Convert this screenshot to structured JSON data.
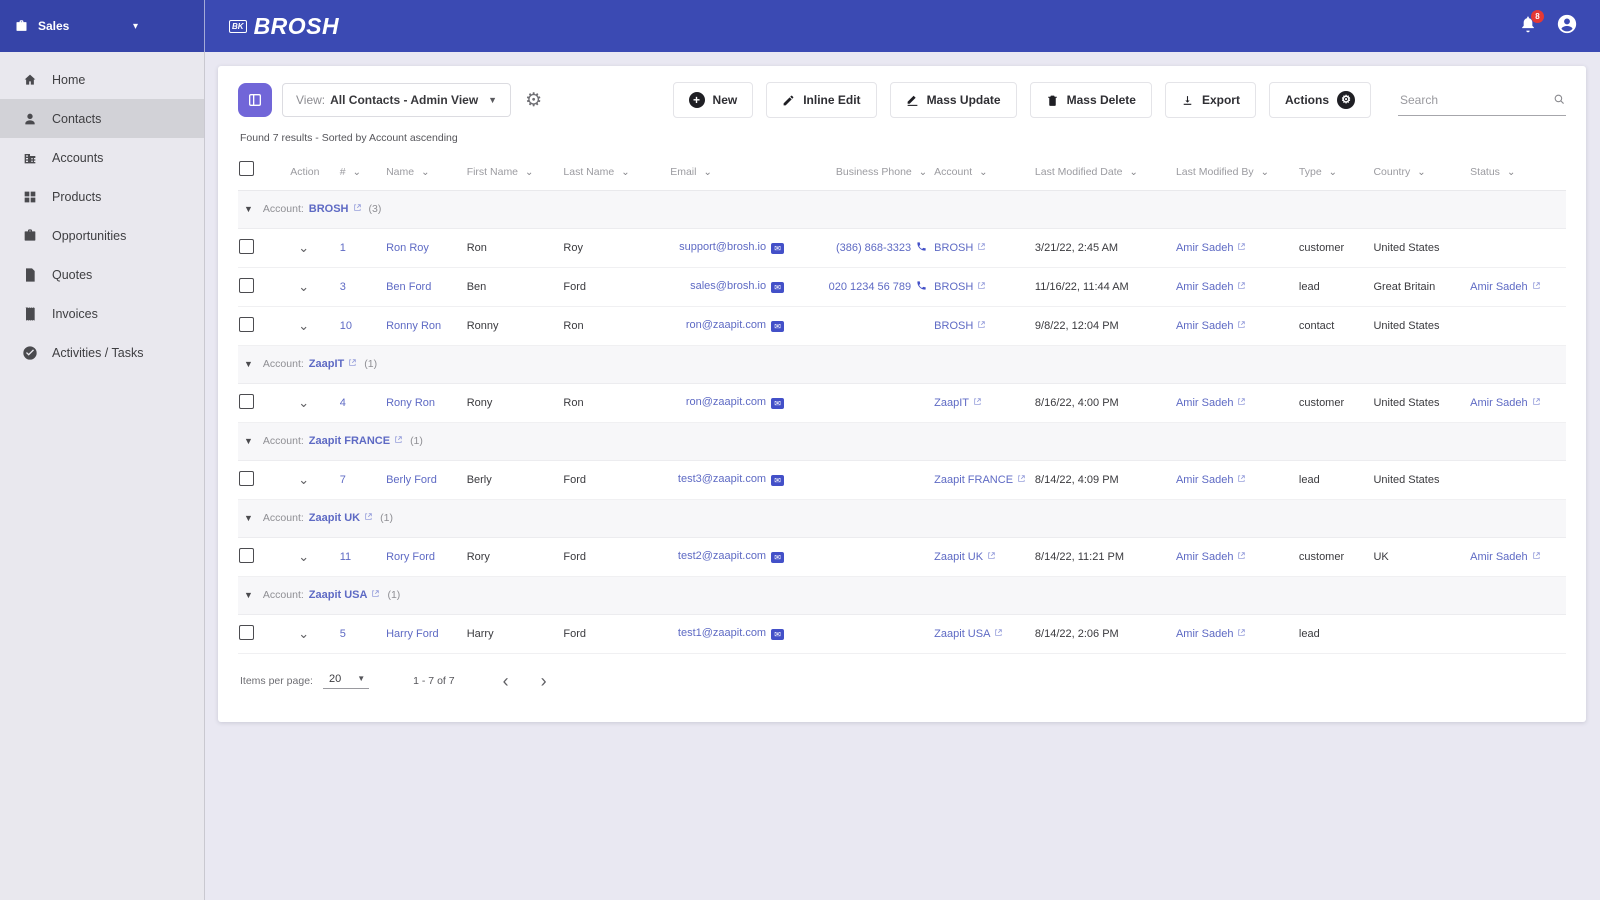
{
  "colors": {
    "topbar": "#3b4ab3",
    "link": "#5e6ac4",
    "view_icon_bg": "#7166d8",
    "notification_badge": "#e53935",
    "sidebar_active": "#d2d2d7"
  },
  "topbar": {
    "workspace": "Sales",
    "logo_badge": "BK",
    "logo": "BROSH",
    "notification_count": "8"
  },
  "sidebar": {
    "items": [
      {
        "label": "Home",
        "icon": "home",
        "active": false
      },
      {
        "label": "Contacts",
        "icon": "person",
        "active": true
      },
      {
        "label": "Accounts",
        "icon": "building",
        "active": false
      },
      {
        "label": "Products",
        "icon": "grid",
        "active": false
      },
      {
        "label": "Opportunities",
        "icon": "briefcase",
        "active": false
      },
      {
        "label": "Quotes",
        "icon": "doc",
        "active": false
      },
      {
        "label": "Invoices",
        "icon": "receipt",
        "active": false
      },
      {
        "label": "Activities / Tasks",
        "icon": "check",
        "active": false
      }
    ]
  },
  "toolbar": {
    "view_label": "View:",
    "view_value": "All Contacts - Admin View",
    "buttons": {
      "new": "New",
      "inline_edit": "Inline Edit",
      "mass_update": "Mass Update",
      "mass_delete": "Mass Delete",
      "export": "Export",
      "actions": "Actions"
    },
    "search_placeholder": "Search"
  },
  "results_summary": "Found 7 results - Sorted by Account ascending",
  "table": {
    "group_prefix": "Account:",
    "columns": [
      {
        "label": "Action",
        "filter": false
      },
      {
        "label": "#",
        "filter": true
      },
      {
        "label": "Name",
        "filter": true
      },
      {
        "label": "First Name",
        "filter": true
      },
      {
        "label": "Last Name",
        "filter": true
      },
      {
        "label": "Email",
        "filter": true
      },
      {
        "label": "Business Phone",
        "filter": true
      },
      {
        "label": "Account",
        "filter": true
      },
      {
        "label": "Last Modified Date",
        "filter": true
      },
      {
        "label": "Last Modified By",
        "filter": true
      },
      {
        "label": "Type",
        "filter": true
      },
      {
        "label": "Country",
        "filter": true
      },
      {
        "label": "Status",
        "filter": true
      }
    ],
    "groups": [
      {
        "account": "BROSH",
        "count": 3,
        "rows": [
          {
            "num": "1",
            "name": "Ron Roy",
            "first_name": "Ron",
            "last_name": "Roy",
            "email": "support@brosh.io",
            "phone": "(386) 868-3323",
            "account": "BROSH",
            "last_modified_date": "3/21/22, 2:45 AM",
            "last_modified_by": "Amir Sadeh",
            "type": "customer",
            "country": "United States",
            "status": ""
          },
          {
            "num": "3",
            "name": "Ben Ford",
            "first_name": "Ben",
            "last_name": "Ford",
            "email": "sales@brosh.io",
            "phone": "020 1234 56 789",
            "account": "BROSH",
            "last_modified_date": "11/16/22, 11:44 AM",
            "last_modified_by": "Amir Sadeh",
            "type": "lead",
            "country": "Great Britain",
            "status": "Amir Sadeh"
          },
          {
            "num": "10",
            "name": "Ronny Ron",
            "first_name": "Ronny",
            "last_name": "Ron",
            "email": "ron@zaapit.com",
            "phone": "",
            "account": "BROSH",
            "last_modified_date": "9/8/22, 12:04 PM",
            "last_modified_by": "Amir Sadeh",
            "type": "contact",
            "country": "United States",
            "status": ""
          }
        ]
      },
      {
        "account": "ZaapIT",
        "count": 1,
        "rows": [
          {
            "num": "4",
            "name": "Rony Ron",
            "first_name": "Rony",
            "last_name": "Ron",
            "email": "ron@zaapit.com",
            "phone": "",
            "account": "ZaapIT",
            "last_modified_date": "8/16/22, 4:00 PM",
            "last_modified_by": "Amir Sadeh",
            "type": "customer",
            "country": "United States",
            "status": "Amir Sadeh"
          }
        ]
      },
      {
        "account": "Zaapit FRANCE",
        "count": 1,
        "rows": [
          {
            "num": "7",
            "name": "Berly Ford",
            "first_name": "Berly",
            "last_name": "Ford",
            "email": "test3@zaapit.com",
            "phone": "",
            "account": "Zaapit FRANCE",
            "last_modified_date": "8/14/22, 4:09 PM",
            "last_modified_by": "Amir Sadeh",
            "type": "lead",
            "country": "United States",
            "status": ""
          }
        ]
      },
      {
        "account": "Zaapit UK",
        "count": 1,
        "rows": [
          {
            "num": "11",
            "name": "Rory Ford",
            "first_name": "Rory",
            "last_name": "Ford",
            "email": "test2@zaapit.com",
            "phone": "",
            "account": "Zaapit UK",
            "last_modified_date": "8/14/22, 11:21 PM",
            "last_modified_by": "Amir Sadeh",
            "type": "customer",
            "country": "UK",
            "status": "Amir Sadeh"
          }
        ]
      },
      {
        "account": "Zaapit USA",
        "count": 1,
        "rows": [
          {
            "num": "5",
            "name": "Harry Ford",
            "first_name": "Harry",
            "last_name": "Ford",
            "email": "test1@zaapit.com",
            "phone": "",
            "account": "Zaapit USA",
            "last_modified_date": "8/14/22, 2:06 PM",
            "last_modified_by": "Amir Sadeh",
            "type": "lead",
            "country": "",
            "status": ""
          }
        ]
      }
    ]
  },
  "pagination": {
    "items_per_page_label": "Items per page:",
    "items_per_page": "20",
    "range": "1 - 7 of 7"
  }
}
